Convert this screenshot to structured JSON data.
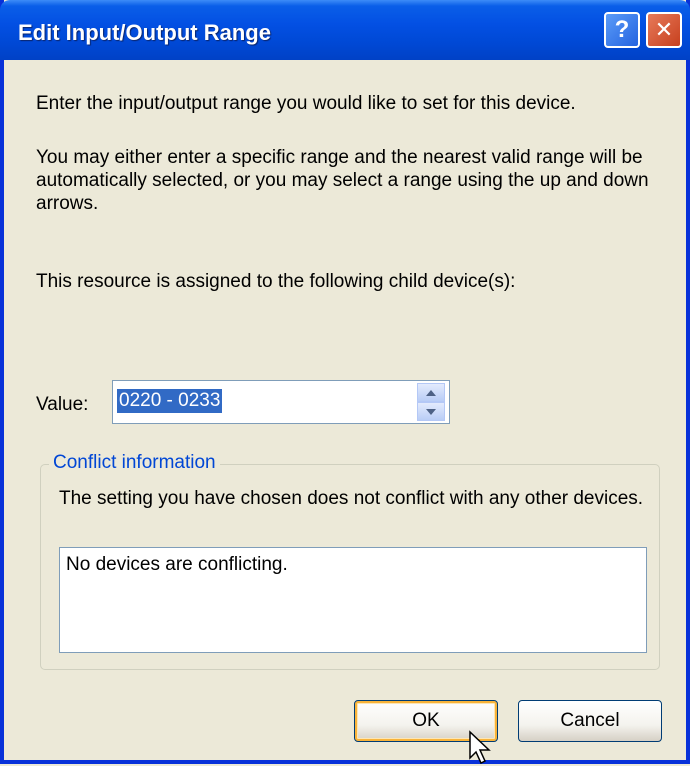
{
  "window": {
    "title": "Edit Input/Output Range"
  },
  "titlebar": {
    "help_glyph": "?",
    "close_glyph": "✕"
  },
  "text": {
    "intro": "Enter the input/output range you would like to set for this device.",
    "instructions": "You may either enter a specific range and the nearest valid range will be automatically selected, or you may select a range using the up and down arrows.",
    "assigned": "This resource is assigned to the following child device(s):"
  },
  "value": {
    "label": "Value:",
    "current": "0220 - 0233",
    "up_icon": "spin-up-arrow",
    "down_icon": "spin-down-arrow"
  },
  "conflict": {
    "title": "Conflict information",
    "description": "The setting you have chosen does not conflict with any other devices.",
    "items": [
      "No devices are conflicting."
    ]
  },
  "buttons": {
    "ok": "OK",
    "cancel": "Cancel"
  },
  "colors": {
    "titlebar": "#0049d6",
    "dialog_bg": "#ece9d8",
    "selection": "#316ac5",
    "group_title": "#0046d5"
  }
}
